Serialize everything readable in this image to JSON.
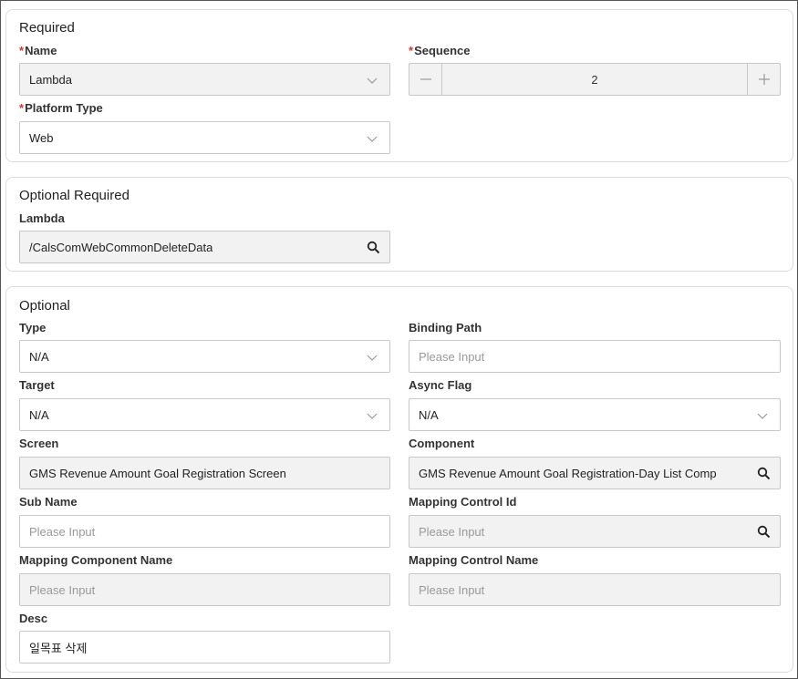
{
  "required": {
    "title": "Required",
    "required_marker": "*",
    "name_label": "Name",
    "name_value": "Lambda",
    "sequence_label": "Sequence",
    "sequence_value": "2",
    "platform_type_label": "Platform Type",
    "platform_type_value": "Web"
  },
  "optional_required": {
    "title": "Optional Required",
    "lambda_label": "Lambda",
    "lambda_value": "/CalsComWebCommonDeleteData"
  },
  "optional": {
    "title": "Optional",
    "type_label": "Type",
    "type_value": "N/A",
    "binding_path_label": "Binding Path",
    "binding_path_placeholder": "Please Input",
    "target_label": "Target",
    "target_value": "N/A",
    "async_flag_label": "Async Flag",
    "async_flag_value": "N/A",
    "screen_label": "Screen",
    "screen_value": "GMS Revenue Amount Goal Registration Screen",
    "component_label": "Component",
    "component_value": "GMS Revenue Amount Goal Registration-Day List Comp",
    "sub_name_label": "Sub Name",
    "sub_name_placeholder": "Please Input",
    "mapping_control_id_label": "Mapping Control Id",
    "mapping_control_id_placeholder": "Please Input",
    "mapping_component_name_label": "Mapping Component Name",
    "mapping_component_name_placeholder": "Please Input",
    "mapping_control_name_label": "Mapping Control Name",
    "mapping_control_name_placeholder": "Please Input",
    "desc_label": "Desc",
    "desc_value": "일목표 삭제"
  },
  "icons": {
    "chevron": "chevron-down-icon",
    "search": "search-icon",
    "minus": "minus-icon",
    "plus": "plus-icon"
  },
  "colors": {
    "required_marker": "#e0322d",
    "readonly_bg": "#f2f2f2",
    "border": "#c8c8c8"
  }
}
